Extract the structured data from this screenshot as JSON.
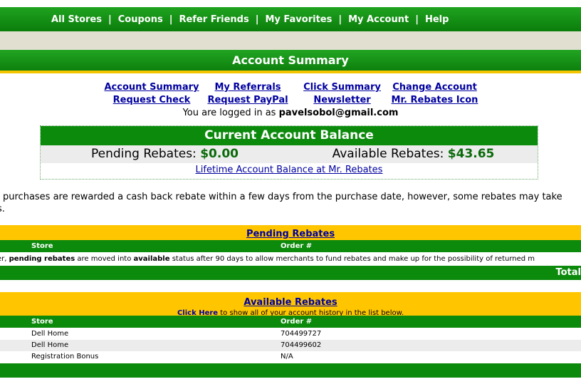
{
  "nav": {
    "items": [
      "All Stores",
      "Coupons",
      "Refer Friends",
      "My Favorites",
      "My Account",
      "Help"
    ],
    "separator": "|"
  },
  "title": "Account Summary",
  "links": {
    "row1": [
      "Account Summary",
      "My Referrals",
      "Click Summary",
      "Change Account"
    ],
    "row2": [
      "Request Check",
      "Request PayPal",
      "Newsletter",
      "Mr. Rebates Icon"
    ]
  },
  "login": {
    "prefix": "You are logged in as",
    "email": "pavelsobol@gmail.com"
  },
  "balance": {
    "header": "Current Account Balance",
    "pending_label": "Pending Rebates:",
    "pending_value": "$0.00",
    "available_label": "Available Rebates:",
    "available_value": "$43.65",
    "lifetime_link": "Lifetime Account Balance at Mr. Rebates"
  },
  "intro": {
    "line1": "st purchases are rewarded a cash back rebate within a few days from the purchase date, however, some rebates may take",
    "line2": "es."
  },
  "pending": {
    "title": "Pending Rebates",
    "columns": [
      "Store",
      "Order #"
    ],
    "note_prefix": "er,",
    "note_bold1": "pending rebates",
    "note_mid": "are moved into",
    "note_bold2": "available",
    "note_suffix": "status after 90 days to allow merchants to fund rebates and make up for the possibility of returned m",
    "total_label": "Total"
  },
  "available": {
    "title": "Available Rebates",
    "click_here": "Click Here",
    "click_suffix": "to show all of your account history in the list below.",
    "columns": [
      "Store",
      "Order #"
    ],
    "rows": [
      {
        "store": "Dell Home",
        "order": "704499727"
      },
      {
        "store": "Dell Home",
        "order": "704499602"
      },
      {
        "store": "Registration Bonus",
        "order": "N/A"
      }
    ]
  }
}
